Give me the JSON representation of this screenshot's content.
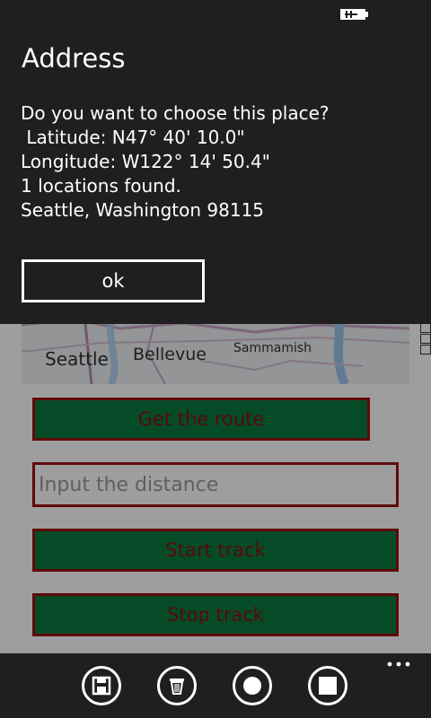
{
  "dialog": {
    "title": "Address",
    "question": "Do you want to choose this place?",
    "latitude": " Latitude: N47° 40' 10.0\"",
    "longitude": "Longitude: W122° 14' 50.4\"",
    "found": "1 locations found.",
    "address": "Seattle, Washington 98115",
    "ok_label": "ok"
  },
  "map": {
    "labels": {
      "seattle": "Seattle",
      "bellevue": "Bellevue",
      "sammamish": "Sammamish"
    }
  },
  "actions": {
    "get_route": "Get the route",
    "distance_placeholder": "Input the distance",
    "start_track": "Start track",
    "stop_track": "Stop track"
  },
  "app_bar": {
    "icons": [
      "save-icon",
      "delete-icon",
      "record-icon",
      "stop-icon"
    ],
    "more": "..."
  },
  "colors": {
    "button_fill": "#0a7a42",
    "button_border": "#9b1010",
    "dialog_bg": "#1f1f1f"
  }
}
